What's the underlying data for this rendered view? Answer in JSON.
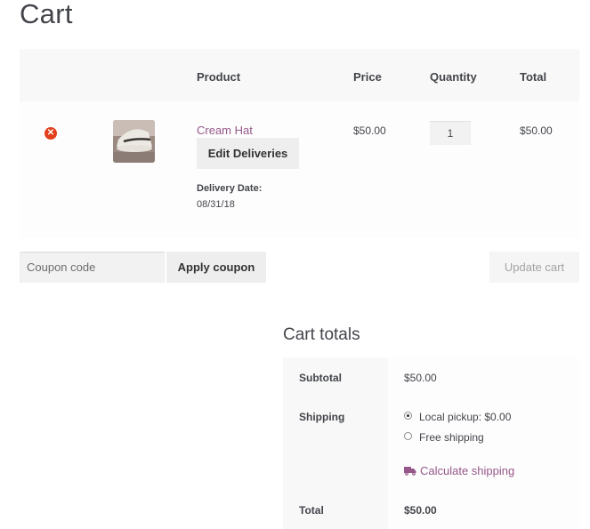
{
  "page": {
    "title": "Cart"
  },
  "cart": {
    "headers": {
      "product": "Product",
      "price": "Price",
      "quantity": "Quantity",
      "total": "Total"
    },
    "items": [
      {
        "remove_icon": "close-circle-icon",
        "name": "Cream Hat",
        "edit_button": "Edit Deliveries",
        "meta_label": "Delivery Date:",
        "meta_value": "08/31/18",
        "price": "$50.00",
        "quantity": "1",
        "total": "$50.00"
      }
    ]
  },
  "actions": {
    "coupon_placeholder": "Coupon code",
    "apply_coupon": "Apply coupon",
    "update_cart": "Update cart"
  },
  "totals": {
    "title": "Cart totals",
    "subtotal_label": "Subtotal",
    "subtotal_value": "$50.00",
    "shipping_label": "Shipping",
    "shipping_options": [
      {
        "label": "Local pickup: $0.00",
        "selected": true
      },
      {
        "label": "Free shipping",
        "selected": false
      }
    ],
    "calculate_shipping": "Calculate shipping",
    "calculate_icon": "truck-icon",
    "total_label": "Total",
    "total_value": "$50.00"
  },
  "colors": {
    "link": "#96588a",
    "remove": "#e2401c",
    "text": "#43454b"
  }
}
